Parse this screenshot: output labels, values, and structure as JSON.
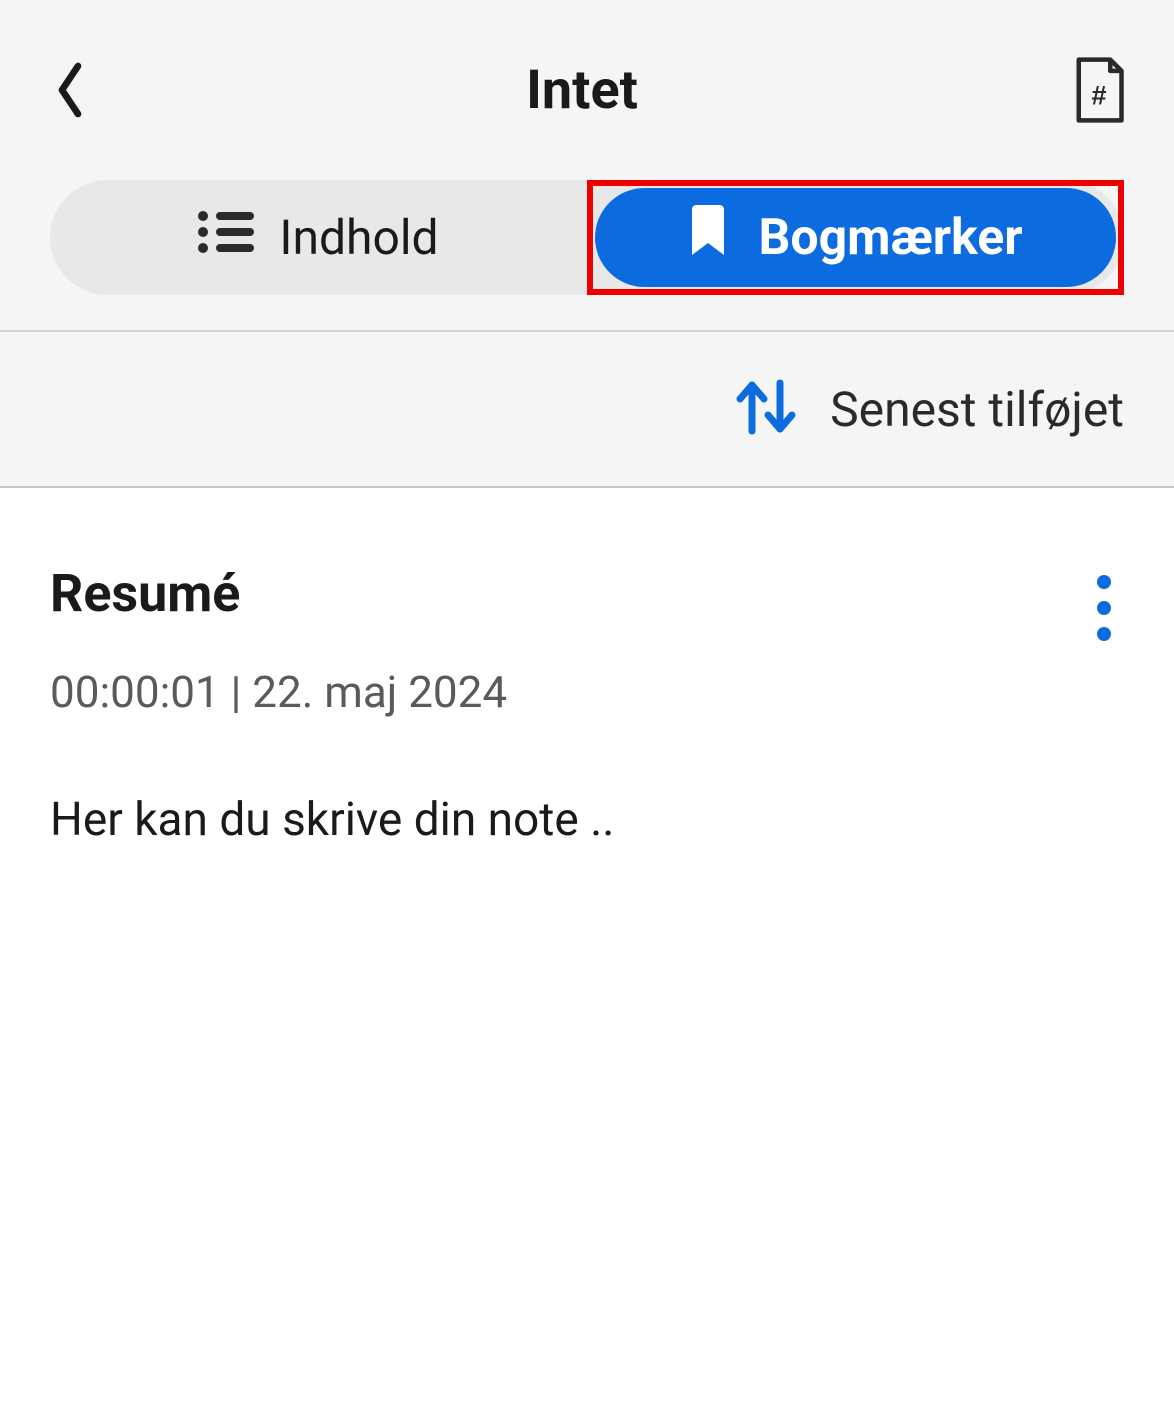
{
  "header": {
    "title": "Intet"
  },
  "tabs": {
    "content_label": "Indhold",
    "bookmarks_label": "Bogmærker",
    "active": "bookmarks"
  },
  "sort": {
    "label": "Senest tilføjet"
  },
  "bookmarks": [
    {
      "title": "Resumé",
      "timestamp": "00:00:01",
      "date": "22. maj 2024",
      "note": "Her kan du skrive din note .."
    }
  ],
  "colors": {
    "primary": "#0d6be0",
    "highlight_border": "#ef0000"
  }
}
